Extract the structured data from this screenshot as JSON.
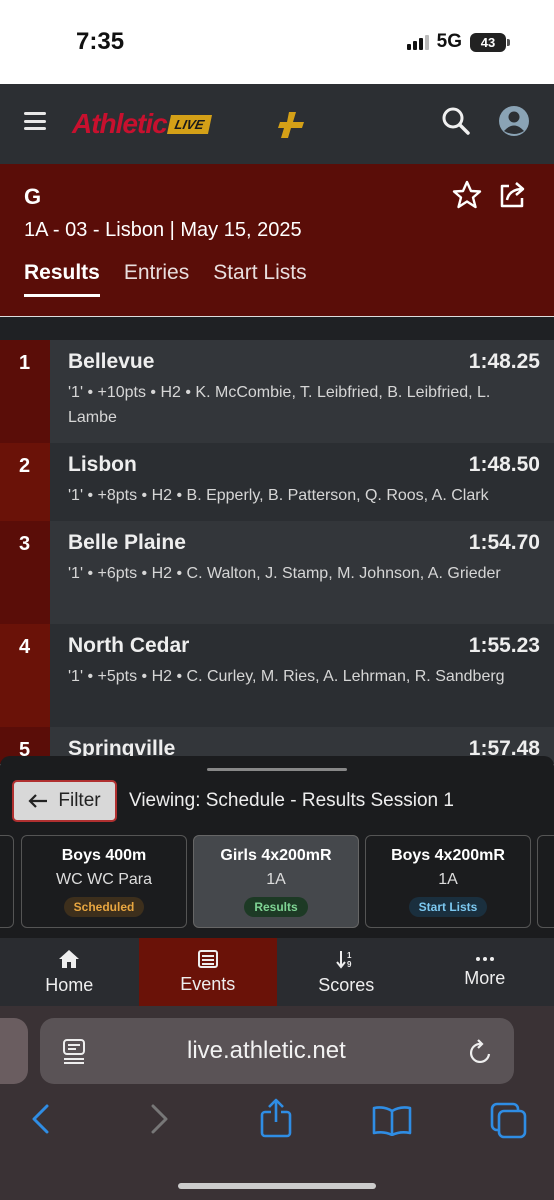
{
  "status": {
    "time": "7:35",
    "network": "5G",
    "battery": "43"
  },
  "header": {
    "logo_text": "Athletic",
    "logo_badge": "LIVE"
  },
  "event": {
    "title": "G",
    "subtitle": "1A - 03 - Lisbon | May 15, 2025",
    "tabs": [
      {
        "label": "Results"
      },
      {
        "label": "Entries"
      },
      {
        "label": "Start Lists"
      }
    ]
  },
  "results": [
    {
      "place": "1",
      "team": "Bellevue",
      "time": "1:48.25",
      "detail": "'1' • +10pts • H2 • K. McCombie, T. Leibfried, B. Leibfried, L. Lambe"
    },
    {
      "place": "2",
      "team": "Lisbon",
      "time": "1:48.50",
      "detail": "'1' • +8pts • H2 • B. Epperly, B. Patterson, Q. Roos, A. Clark"
    },
    {
      "place": "3",
      "team": "Belle Plaine",
      "time": "1:54.70",
      "detail": "'1' • +6pts • H2 • C. Walton, J. Stamp, M. Johnson, A. Grieder"
    },
    {
      "place": "4",
      "team": "North Cedar",
      "time": "1:55.23",
      "detail": "'1' • +5pts • H2 • C. Curley, M. Ries, A. Lehrman, R. Sandberg"
    },
    {
      "place": "5",
      "team": "Springville",
      "time": "1:57.48",
      "detail": ""
    }
  ],
  "filter": {
    "label": "Filter",
    "viewing": "Viewing: Schedule - Results Session 1"
  },
  "schedule_cards": [
    {
      "name": "Boys 400m",
      "sub": "WC WC Para",
      "badge": "Scheduled",
      "badge_bg": "#3d2f1c",
      "badge_fg": "#e8a640"
    },
    {
      "name": "Girls 4x200mR",
      "sub": "1A",
      "badge": "Results",
      "badge_bg": "#1d3a25",
      "badge_fg": "#7fd494"
    },
    {
      "name": "Boys 4x200mR",
      "sub": "1A",
      "badge": "Start Lists",
      "badge_bg": "#1a2f3e",
      "badge_fg": "#7cc8f0"
    }
  ],
  "bottom_nav": [
    {
      "label": "Home",
      "icon": "home-icon"
    },
    {
      "label": "Events",
      "icon": "list-icon"
    },
    {
      "label": "Scores",
      "icon": "sort-icon"
    },
    {
      "label": "More",
      "icon": "more-icon"
    }
  ],
  "browser": {
    "url": "live.athletic.net"
  },
  "colors": {
    "accent": "#5a0d08",
    "active_nav": "#6a1208",
    "place_bg": "#6a1208"
  }
}
